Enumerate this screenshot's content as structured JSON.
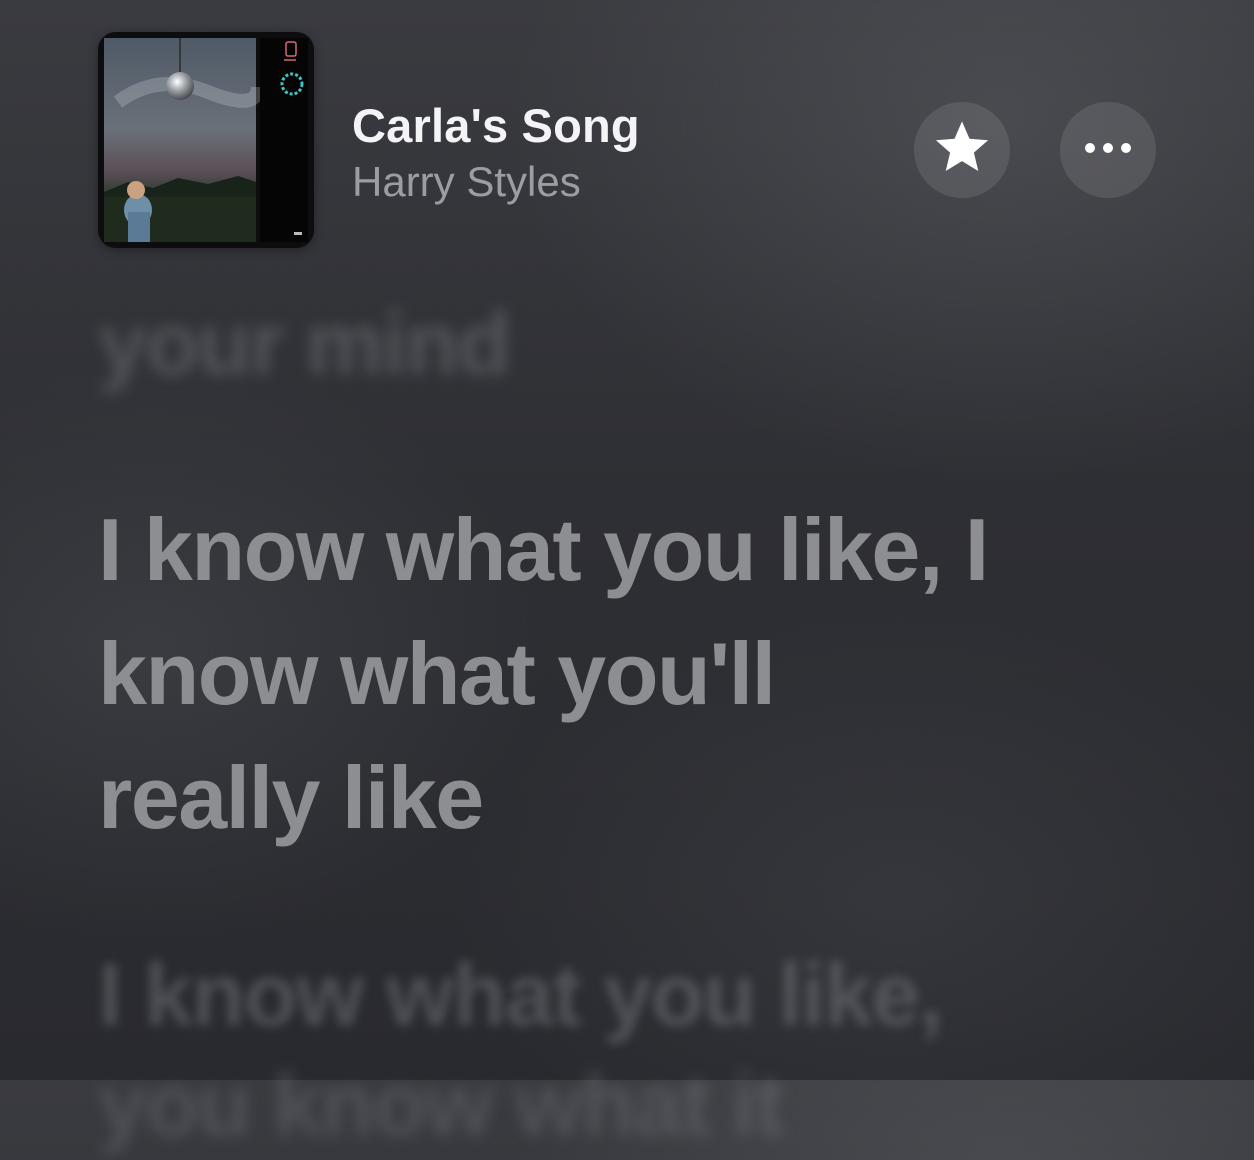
{
  "now_playing": {
    "title": "Carla's Song",
    "artist": "Harry Styles"
  },
  "actions": {
    "favorite_icon": "star-icon",
    "more_icon": "ellipsis-icon"
  },
  "lyrics": {
    "previous": "your mind",
    "current_lines": [
      "I know what you like, I",
      "know what you'll",
      "really like"
    ],
    "next": "I know what you like,",
    "next_partial": "you know what it"
  },
  "colors": {
    "title": "#f4f4f6",
    "artist": "#9c9da2",
    "current_lyric": "#8d8e92",
    "background": "#2e2f34"
  }
}
